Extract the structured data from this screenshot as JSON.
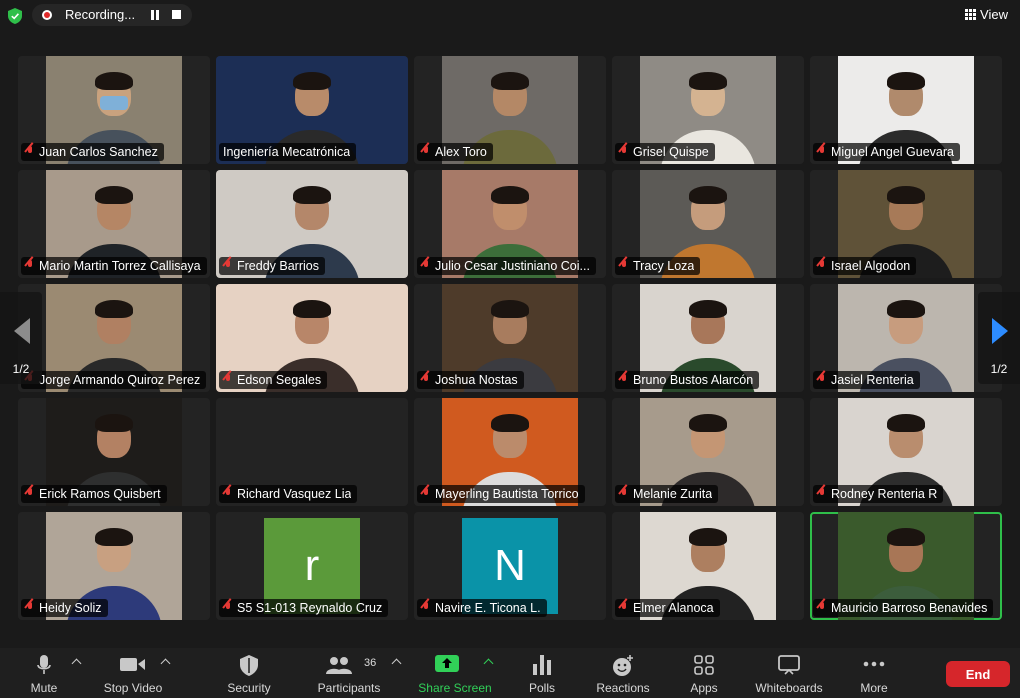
{
  "topbar": {
    "recording_label": "Recording...",
    "view_label": "View"
  },
  "pagination": {
    "left_label": "1/2",
    "right_label": "1/2"
  },
  "participants": [
    {
      "name": "Juan Carlos Sanchez",
      "muted": true,
      "type": "video",
      "bg": "#8a8170",
      "skin": "#c9a27e",
      "shirt": "#47515c",
      "mask": true
    },
    {
      "name": "Ingeniería Mecatrónica",
      "muted": false,
      "type": "video",
      "bg": "#1c2e55",
      "skin": "#b88b6a",
      "shirt": "#2a2a2a"
    },
    {
      "name": "Alex Toro",
      "muted": true,
      "type": "video",
      "bg": "#6e6a66",
      "skin": "#b48866",
      "shirt": "#6c6a3c"
    },
    {
      "name": "Grisel Quispe",
      "muted": true,
      "type": "video",
      "bg": "#8f8b85",
      "skin": "#d4b391",
      "shirt": "#e9e6df"
    },
    {
      "name": "Miguel Angel Guevara",
      "muted": true,
      "type": "video",
      "bg": "#ecebea",
      "skin": "#b08a6c",
      "shirt": "#2b2b2b"
    },
    {
      "name": "Mario Martin Torrez Callisaya",
      "muted": true,
      "type": "video",
      "bg": "#a89a8b",
      "skin": "#b58665",
      "shirt": "#1f2327"
    },
    {
      "name": "Freddy Barrios",
      "muted": true,
      "type": "video",
      "bg": "#cfcac4",
      "skin": "#b4876a",
      "shirt": "#2d3a4c"
    },
    {
      "name": "Julio Cesar Justiniano Coi...",
      "muted": true,
      "type": "video",
      "bg": "#a77a68",
      "skin": "#c08e6c",
      "shirt": "#3c6e3a"
    },
    {
      "name": "Tracy Loza",
      "muted": true,
      "type": "video",
      "bg": "#5c5a56",
      "skin": "#c59c7c",
      "shirt": "#c0772f"
    },
    {
      "name": "Israel Algodon",
      "muted": true,
      "type": "video",
      "bg": "#5f5238",
      "skin": "#a77a58",
      "shirt": "#1d1d1d"
    },
    {
      "name": "Jorge Armando Quiroz Perez",
      "muted": true,
      "type": "video",
      "bg": "#9b8a72",
      "skin": "#b08062",
      "shirt": "#292929"
    },
    {
      "name": "Edson Segales",
      "muted": true,
      "type": "video",
      "bg": "#e6d2c3",
      "skin": "#b88669",
      "shirt": "#3a2e2a"
    },
    {
      "name": "Joshua Nostas",
      "muted": true,
      "type": "video",
      "bg": "#4e3b2a",
      "skin": "#a87c5e",
      "shirt": "#3b3b40"
    },
    {
      "name": "Bruno Bustos Alarcón",
      "muted": true,
      "type": "video",
      "bg": "#d9d4ce",
      "skin": "#a8775a",
      "shirt": "#2a4a2c"
    },
    {
      "name": "Jasiel Renteria",
      "muted": true,
      "type": "video",
      "bg": "#bcb6ae",
      "skin": "#c79c7e",
      "shirt": "#4a5060"
    },
    {
      "name": "Erick Ramos Quisbert",
      "muted": true,
      "type": "video",
      "bg": "#1e1c1a",
      "skin": "#b38163",
      "shirt": "#2e2f2f"
    },
    {
      "name": "Richard Vasquez Lia",
      "muted": true,
      "type": "blank"
    },
    {
      "name": "Mayerling Bautista Torrico",
      "muted": true,
      "type": "video",
      "bg": "#d05a1f",
      "skin": "#bb8b6b",
      "shirt": "#dcdcdc"
    },
    {
      "name": "Melanie Zurita",
      "muted": true,
      "type": "video",
      "bg": "#a79b8c",
      "skin": "#c49674",
      "shirt": "#2d2a2a"
    },
    {
      "name": "Rodney Renteria R",
      "muted": true,
      "type": "video",
      "bg": "#d9d4cf",
      "skin": "#b98d6e",
      "shirt": "#2d2d2d"
    },
    {
      "name": "Heidy Soliz",
      "muted": true,
      "type": "video",
      "bg": "#b0a598",
      "skin": "#c8a081",
      "shirt": "#2d3a7a"
    },
    {
      "name": "S5 S1-013 Reynaldo Cruz",
      "muted": true,
      "type": "avatar",
      "letter": "r",
      "color": "#5b9a3a"
    },
    {
      "name": "Navire E. Ticona L.",
      "muted": true,
      "type": "avatar",
      "letter": "N",
      "color": "#0a93a8"
    },
    {
      "name": "Elmer Alanoca",
      "muted": true,
      "type": "video",
      "bg": "#ddd8d1",
      "skin": "#ad7f60",
      "shirt": "#222222"
    },
    {
      "name": "Mauricio Barroso Benavides",
      "muted": true,
      "type": "video",
      "bg": "#3a5a2c",
      "skin": "#a87656",
      "shirt": "#3c5d3c",
      "active": true
    }
  ],
  "toolbar": {
    "mute": "Mute",
    "stop_video": "Stop Video",
    "security": "Security",
    "participants": "Participants",
    "participants_count": "36",
    "share_screen": "Share Screen",
    "polls": "Polls",
    "reactions": "Reactions",
    "apps": "Apps",
    "whiteboards": "Whiteboards",
    "more": "More",
    "end": "End"
  },
  "colors": {
    "accent_green": "#31d058",
    "end_red": "#d6262b",
    "arrow_blue": "#2d8cff",
    "active_border": "#2fbf4a",
    "muted_red": "#e53935"
  }
}
